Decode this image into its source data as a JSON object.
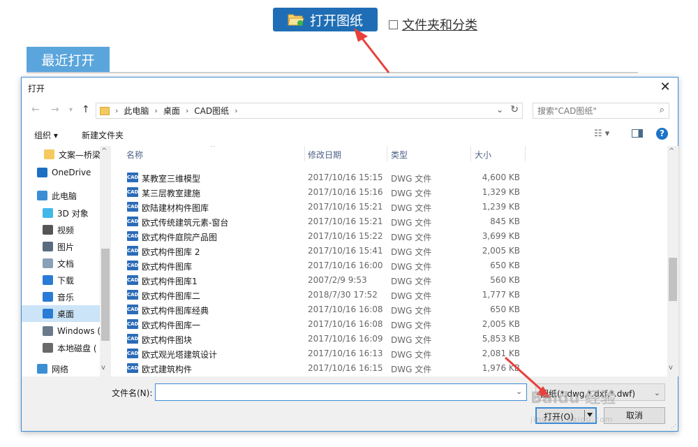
{
  "app": {
    "open_drawing_label": "打开图纸",
    "category_label": "文件夹和分类",
    "recent_tab": "最近打开"
  },
  "dialog": {
    "title": "打开",
    "address": {
      "crumbs": [
        "此电脑",
        "桌面",
        "CAD图纸"
      ]
    },
    "search_placeholder": "搜索\"CAD图纸\"",
    "toolbar": {
      "organize": "组织",
      "new_folder": "新建文件夹"
    },
    "nav": [
      {
        "label": "文案—桥梁",
        "icon": "folder-icon",
        "color": "#f4c95d"
      },
      {
        "label": "OneDrive",
        "icon": "cloud-icon",
        "color": "#1c6fc2"
      },
      {
        "label": "此电脑",
        "icon": "computer-icon",
        "color": "#3c8ed4"
      },
      {
        "label": "3D 对象",
        "icon": "cube-icon",
        "color": "#43b7e8"
      },
      {
        "label": "视频",
        "icon": "video-icon",
        "color": "#555555"
      },
      {
        "label": "图片",
        "icon": "picture-icon",
        "color": "#5a6a80"
      },
      {
        "label": "文档",
        "icon": "document-icon",
        "color": "#8aa0b8"
      },
      {
        "label": "下载",
        "icon": "download-icon",
        "color": "#2a7bd5"
      },
      {
        "label": "音乐",
        "icon": "music-icon",
        "color": "#2a7bd5"
      },
      {
        "label": "桌面",
        "icon": "desktop-icon",
        "color": "#2a7bd5"
      },
      {
        "label": "Windows (",
        "icon": "drive-icon",
        "color": "#6a7a8a"
      },
      {
        "label": "本地磁盘 (",
        "icon": "drive-icon",
        "color": "#6a6a6a"
      },
      {
        "label": "网络",
        "icon": "network-icon",
        "color": "#3c8ed4"
      }
    ],
    "columns": {
      "name": "名称",
      "date": "修改日期",
      "type": "类型",
      "size": "大小"
    },
    "files": [
      {
        "name": "某教室三维模型",
        "date": "2017/10/16 15:15",
        "type": "DWG 文件",
        "size": "4,600 KB"
      },
      {
        "name": "某三层教室建施",
        "date": "2017/10/16 15:16",
        "type": "DWG 文件",
        "size": "1,329 KB"
      },
      {
        "name": "欧陆建材构件图库",
        "date": "2017/10/16 15:21",
        "type": "DWG 文件",
        "size": "1,239 KB"
      },
      {
        "name": "欧式传统建筑元素-窗台",
        "date": "2017/10/16 15:21",
        "type": "DWG 文件",
        "size": "845 KB"
      },
      {
        "name": "欧式构件庭院产品图",
        "date": "2017/10/16 15:22",
        "type": "DWG 文件",
        "size": "3,699 KB"
      },
      {
        "name": "欧式构件图库 2",
        "date": "2017/10/16 15:41",
        "type": "DWG 文件",
        "size": "2,005 KB"
      },
      {
        "name": "欧式构件图库",
        "date": "2017/10/16 16:00",
        "type": "DWG 文件",
        "size": "650 KB"
      },
      {
        "name": "欧式构件图库1",
        "date": "2007/2/9 9:53",
        "type": "DWG 文件",
        "size": "560 KB"
      },
      {
        "name": "欧式构件图库二",
        "date": "2018/7/30 17:52",
        "type": "DWG 文件",
        "size": "1,777 KB"
      },
      {
        "name": "欧式构件图库经典",
        "date": "2017/10/16 16:08",
        "type": "DWG 文件",
        "size": "650 KB"
      },
      {
        "name": "欧式构件图库一",
        "date": "2017/10/16 16:08",
        "type": "DWG 文件",
        "size": "2,005 KB"
      },
      {
        "name": "欧式构件图块",
        "date": "2017/10/16 16:09",
        "type": "DWG 文件",
        "size": "5,853 KB"
      },
      {
        "name": "欧式观光塔建筑设计",
        "date": "2017/10/16 16:13",
        "type": "DWG 文件",
        "size": "2,081 KB"
      },
      {
        "name": "欧式建筑构件",
        "date": "2017/10/16 16:15",
        "type": "DWG 文件",
        "size": "1,976 KB"
      }
    ],
    "filename_label": "文件名(N):",
    "filename_value": "",
    "filter_label": "图纸(*.dwg,*.dxf,*.dwf)",
    "open_button": "打开(O)",
    "cancel_button": "取消",
    "cad_badge": "CAD"
  },
  "watermark": {
    "brand": "Baidu 经验",
    "url": "jingyan.baidu.com"
  },
  "colors": {
    "accent": "#1f6eb5",
    "arrow": "#e8403b",
    "selection": "#cce4f7"
  }
}
